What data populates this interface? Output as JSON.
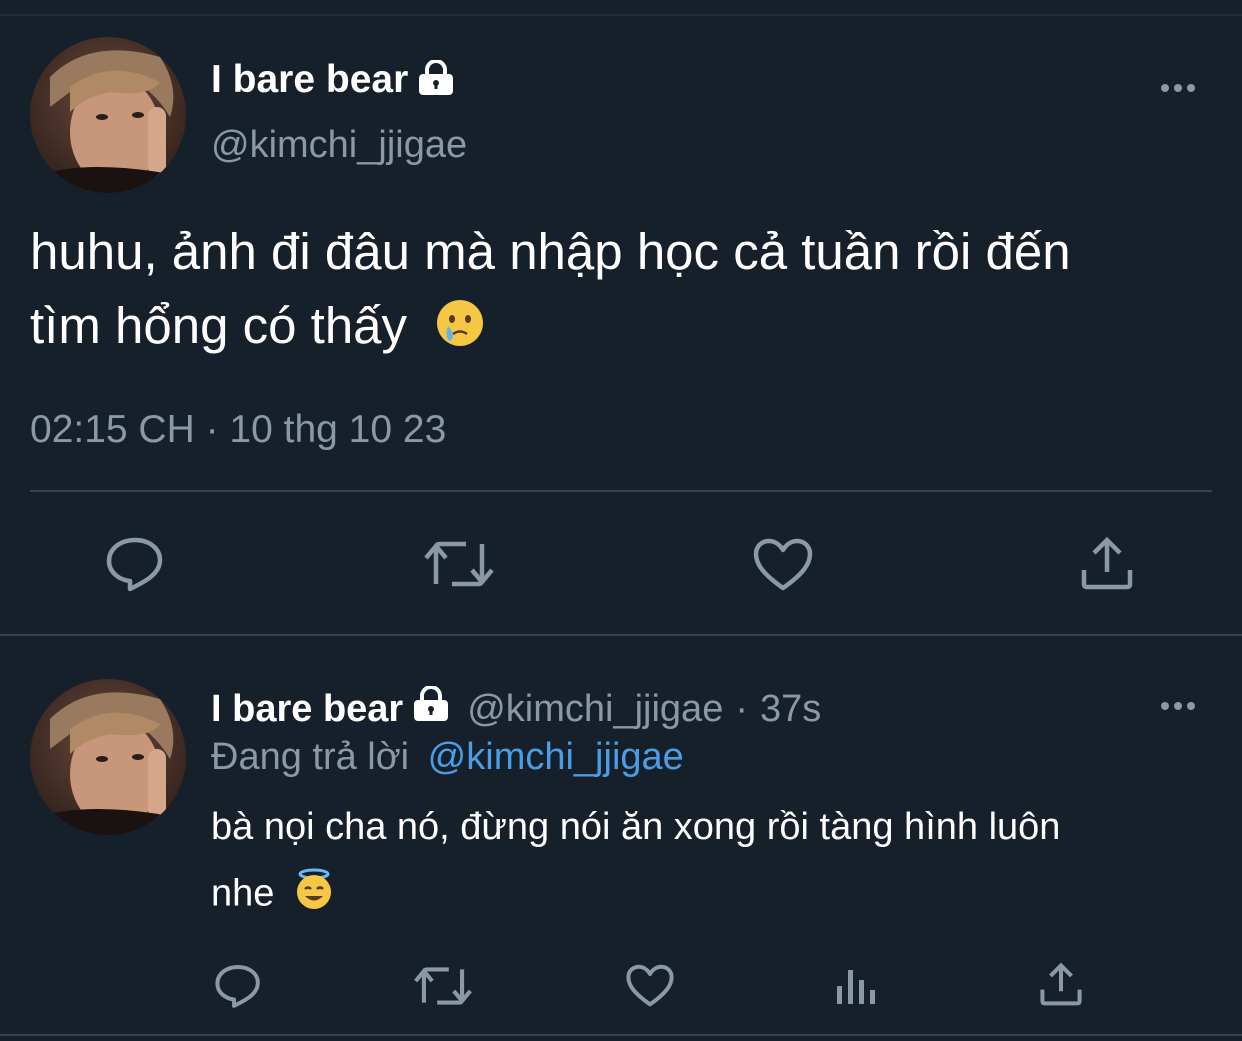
{
  "main_tweet": {
    "display_name": "I bare bear",
    "handle": "@kimchi_jjigae",
    "text_line1": "huhu, ảnh đi đâu mà nhập học cả tuần rồi đến",
    "text_line2": "tìm hổng có thấy",
    "emoji": "crying-face",
    "timestamp": "02:15 CH · 10 thg 10 23"
  },
  "reply_tweet": {
    "display_name": "I bare bear",
    "handle": "@kimchi_jjigae",
    "separator": "·",
    "age": "37s",
    "replying_to_prefix": "Đang trả lời",
    "replying_to_handle": "@kimchi_jjigae",
    "text_line1": "bà nọi cha nó, đừng nói ăn xong rồi tàng hình luôn",
    "text_line2": "nhe",
    "emoji": "smiling-face-with-halo"
  },
  "colors": {
    "background": "#15202b",
    "secondary_text": "#8b98a5",
    "link": "#4a9de6",
    "divider": "#38444d"
  },
  "icons": {
    "main_actions": [
      "reply-icon",
      "retweet-icon",
      "like-icon",
      "share-icon"
    ],
    "reply_actions": [
      "reply-icon",
      "retweet-icon",
      "like-icon",
      "analytics-icon",
      "share-icon"
    ]
  }
}
